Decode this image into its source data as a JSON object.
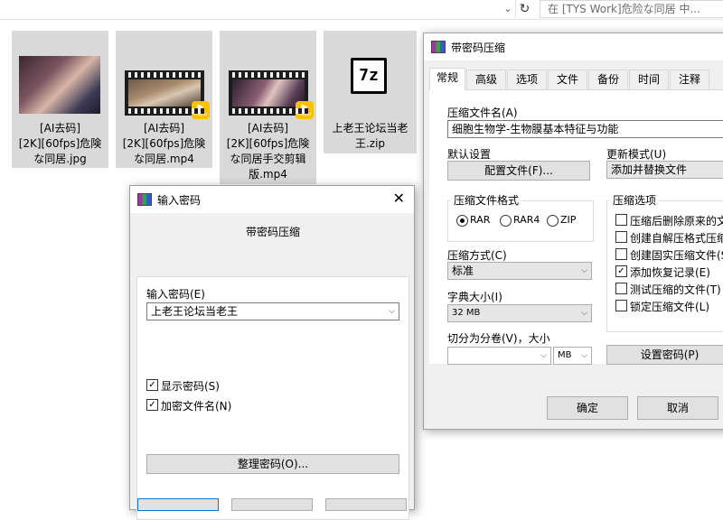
{
  "explorer": {
    "search_placeholder": "在 [TYS Work]危险な同居 中...",
    "files": [
      {
        "name_lines": [
          "[AI去码]",
          "[2K][60fps]危険",
          "な同居.jpg"
        ],
        "kind": "image"
      },
      {
        "name_lines": [
          "[AI去码]",
          "[2K][60fps]危険",
          "な同居.mp4"
        ],
        "kind": "video"
      },
      {
        "name_lines": [
          "[AI去码]",
          "[2K][60fps]危険",
          "な同居手交剪辑",
          "版.mp4"
        ],
        "kind": "video"
      },
      {
        "name_lines": [
          "上老王论坛当老",
          "王.zip"
        ],
        "kind": "7z"
      }
    ],
    "player_badge": "Player",
    "sevenz_glyph": "7z"
  },
  "archive_dialog": {
    "title": "带密码压缩",
    "tabs": [
      "常规",
      "高级",
      "选项",
      "文件",
      "备份",
      "时间",
      "注释"
    ],
    "archive_name_label": "压缩文件名(A)",
    "archive_name_value": "细胞生物学-生物膜基本特征与功能",
    "default_settings_label": "默认设置",
    "profiles_button": "配置文件(F)...",
    "update_mode_label": "更新模式(U)",
    "update_mode_value": "添加并替换文件",
    "format_group_title": "压缩文件格式",
    "format_options": [
      "RAR",
      "RAR4",
      "ZIP"
    ],
    "format_selected": "RAR",
    "method_label": "压缩方式(C)",
    "method_value": "标准",
    "dict_label": "字典大小(I)",
    "dict_value": "32 MB",
    "split_label": "切分为分卷(V)，大小",
    "split_value": "",
    "split_unit": "MB",
    "options_group_title": "压缩选项",
    "options": [
      {
        "label": "压缩后删除原来的文",
        "checked": false
      },
      {
        "label": "创建自解压格式压缩",
        "checked": false
      },
      {
        "label": "创建固实压缩文件(S",
        "checked": false
      },
      {
        "label": "添加恢复记录(E)",
        "checked": true
      },
      {
        "label": "测试压缩的文件(T)",
        "checked": false
      },
      {
        "label": "锁定压缩文件(L)",
        "checked": false
      }
    ],
    "set_password_button": "设置密码(P)",
    "ok_button": "确定",
    "cancel_button": "取消"
  },
  "password_dialog": {
    "title": "输入密码",
    "heading": "带密码压缩",
    "password_label": "输入密码(E)",
    "password_value": "上老王论坛当老王",
    "show_password_label": "显示密码(S)",
    "show_password_checked": true,
    "encrypt_names_label": "加密文件名(N)",
    "encrypt_names_checked": true,
    "organize_button": "整理密码(O)..."
  }
}
